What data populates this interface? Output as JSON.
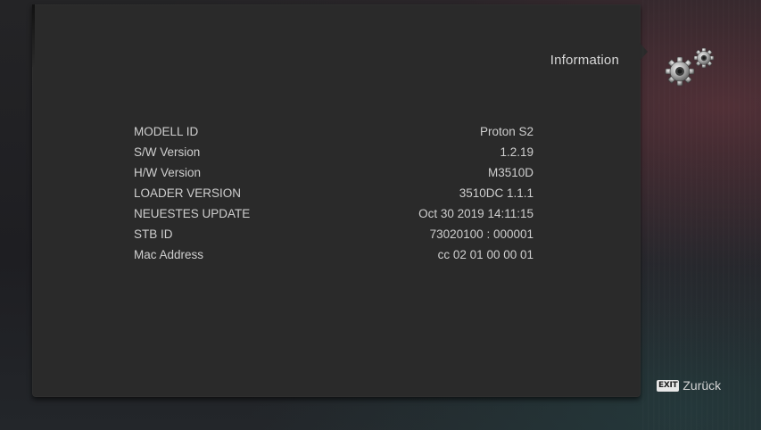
{
  "header": {
    "title": "Information",
    "icon": "settings-gears-icon"
  },
  "info": {
    "rows": [
      {
        "label": "MODELL ID",
        "value": "Proton S2"
      },
      {
        "label": "S/W Version",
        "value": "1.2.19"
      },
      {
        "label": "H/W Version",
        "value": "M3510D"
      },
      {
        "label": "LOADER VERSION",
        "value": "3510DC 1.1.1"
      },
      {
        "label": "NEUESTES UPDATE",
        "value": "Oct 30 2019 14:11:15"
      },
      {
        "label": "STB ID",
        "value": "73020100 : 000001"
      },
      {
        "label": "Mac Address",
        "value": "cc 02 01 00 00 01"
      }
    ]
  },
  "footer": {
    "exit_key": "EXIT",
    "exit_label": "Zurück"
  },
  "colors": {
    "panel": "#2a2a2a",
    "text": "#cfcfcf",
    "accent": "#6a3a44"
  }
}
